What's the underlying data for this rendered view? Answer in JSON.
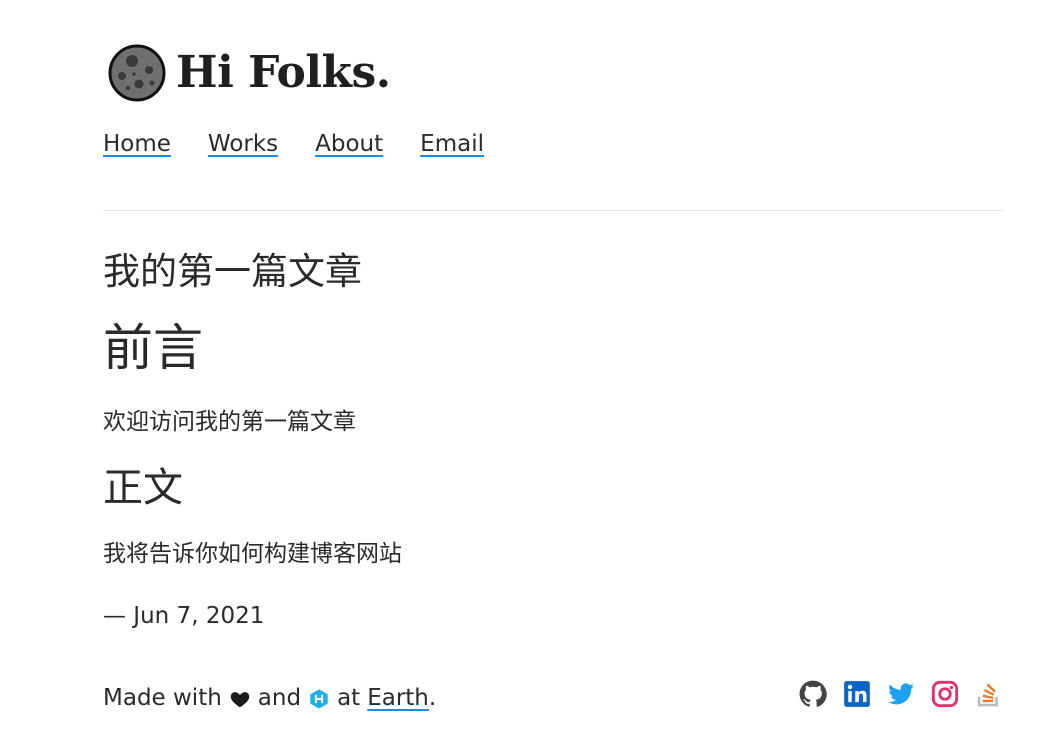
{
  "site": {
    "title": "Hi Folks."
  },
  "nav": {
    "items": [
      {
        "label": "Home"
      },
      {
        "label": "Works"
      },
      {
        "label": "About"
      },
      {
        "label": "Email"
      }
    ]
  },
  "post": {
    "title": "我的第一篇文章",
    "sections": [
      {
        "heading": "前言",
        "text": "欢迎访问我的第一篇文章"
      },
      {
        "heading": "正文",
        "text": "我将告诉你如何构建博客网站"
      }
    ],
    "date": "— Jun 7, 2021"
  },
  "footer": {
    "made_with": "Made with",
    "and": "and",
    "at": "at",
    "location_link": "Earth",
    "period": ".",
    "social_icons": [
      "github-icon",
      "linkedin-icon",
      "twitter-icon",
      "instagram-icon",
      "stackoverflow-icon"
    ]
  },
  "colors": {
    "link_underline": "#1e88e5",
    "linkedin": "#0a66c2",
    "twitter": "#1da1f2",
    "instagram": "#e1306c",
    "stackoverflow": "#e87922",
    "github": "#444444",
    "hugo": "#1eb0e6"
  }
}
